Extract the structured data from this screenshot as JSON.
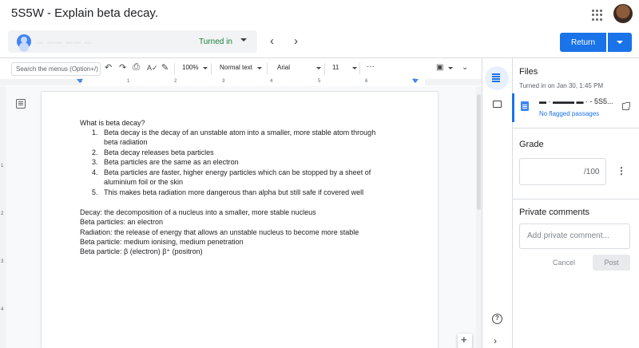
{
  "topbar": {
    "title": "5S5W - Explain beta decay."
  },
  "student": {
    "name": "▬ ▬▬ ▬▬ ▬ ▬",
    "status": "Turned in",
    "prev_icon": "chevron-left-icon",
    "next_icon": "chevron-right-icon"
  },
  "actions": {
    "return_label": "Return"
  },
  "toolbar": {
    "search_placeholder": "Search the menus (Option+/)",
    "zoom": "100%",
    "style": "Normal text",
    "font": "Arial",
    "font_size": "11",
    "more": "···"
  },
  "ruler": {
    "numbers": [
      "1",
      "1",
      "2",
      "3",
      "4",
      "5",
      "6",
      "7"
    ]
  },
  "vruler": {
    "numbers": [
      "1",
      "2",
      "3",
      "4"
    ]
  },
  "document": {
    "question": "What is beta decay?",
    "list": [
      {
        "num": "1.",
        "lines": [
          "Beta decay is the decay of an unstable atom into a smaller, more stable atom through",
          "beta radiation"
        ]
      },
      {
        "num": "2.",
        "lines": [
          "Beta decay releases beta particles"
        ]
      },
      {
        "num": "3.",
        "lines": [
          "Beta particles are the same as an electron"
        ]
      },
      {
        "num": "4.",
        "lines": [
          "Beta particles are faster, higher energy particles which can be stopped by a sheet of",
          "aluminium foil or the skin"
        ]
      },
      {
        "num": "5.",
        "lines": [
          "This makes beta radiation more dangerous than alpha but still safe if covered well"
        ]
      }
    ],
    "notes": [
      "Decay: the decomposition of a nucleus into a smaller, more stable nucleus",
      "Beta particles: an electron",
      "Radiation: the release of energy that allows an unstable nucleus to become more stable",
      "Beta particle: medium ionising, medium penetration",
      "Beta particle: β  (electron)  β⁺ (positron)"
    ]
  },
  "panel": {
    "files_title": "Files",
    "turned_in_time": "Turned in on Jan 30, 1:45 PM",
    "file_name": "▬ · ▬▬▬ ▬ · - 5S5...",
    "file_flag": "No flagged passages",
    "grade_title": "Grade",
    "grade_total": "/100",
    "private_comments_title": "Private comments",
    "comment_placeholder": "Add private comment...",
    "cancel_label": "Cancel",
    "post_label": "Post",
    "help_label": "?"
  },
  "colors": {
    "accent": "#1a73e8",
    "turned_in": "#188038"
  }
}
